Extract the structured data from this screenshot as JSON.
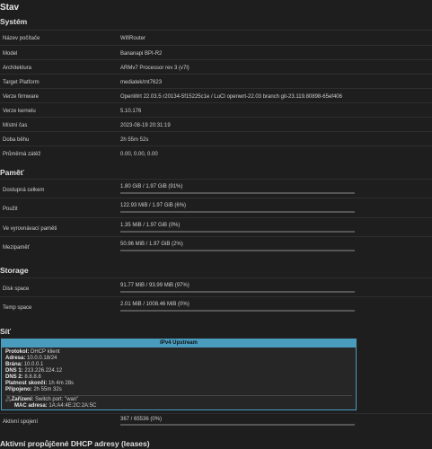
{
  "titles": {
    "main": "Stav",
    "system": "Systém",
    "memory": "Paměť",
    "storage": "Storage",
    "network": "Síť",
    "dhcp": "Aktivní propůjčené DHCP adresy (leases)"
  },
  "system": [
    {
      "label": "Název počítače",
      "value": "WifiRouter"
    },
    {
      "label": "Model",
      "value": "Bananapi BPI-R2"
    },
    {
      "label": "Architektura",
      "value": "ARMv7 Processor rev 3 (v7l)"
    },
    {
      "label": "Target Platform",
      "value": "mediatek/mt7623"
    },
    {
      "label": "Verze firmware",
      "value": "OpenWrt 22.03.5 r20134-5f15225c1e / LuCI openwrt-22.03 branch git-23.119.80898-65ef406"
    },
    {
      "label": "Verze kernelu",
      "value": "5.10.176"
    },
    {
      "label": "Místní čas",
      "value": "2023-08-19 20:31:19"
    },
    {
      "label": "Doba běhu",
      "value": "2h 55m 52s"
    },
    {
      "label": "Průměrná zátěž",
      "value": "0.00, 0.00, 0.00"
    }
  ],
  "memory": [
    {
      "label": "Dostupná celkem",
      "value": "1.80 GiB / 1.97 GiB (91%)",
      "fraction": 0.91
    },
    {
      "label": "Použit",
      "value": "122.93 MiB / 1.97 GiB (6%)",
      "fraction": 0.06
    },
    {
      "label": "Ve vyrovnávací paměti",
      "value": "1.35 MiB / 1.97 GiB (0%)",
      "fraction": 0.0
    },
    {
      "label": "Mezipaměť",
      "value": "50.96 MiB / 1.97 GiB (2%)",
      "fraction": 0.02
    }
  ],
  "storage": [
    {
      "label": "Disk space",
      "value": "91.77 MiB / 93.99 MiB (97%)",
      "fraction": 0.97
    },
    {
      "label": "Temp space",
      "value": "2.01 MiB / 1008.46 MiB (0%)",
      "fraction": 0.0
    }
  ],
  "wan": {
    "header": "IPv4 Upstream",
    "rows": [
      {
        "k": "Protokol:",
        "v": "DHCP klient"
      },
      {
        "k": "Adresa:",
        "v": "10.0.0.18/24"
      },
      {
        "k": "Brána:",
        "v": "10.0.0.1"
      },
      {
        "k": "DNS 1:",
        "v": "213.226.224.12"
      },
      {
        "k": "DNS 2:",
        "v": "8.8.8.8"
      },
      {
        "k": "Platnost skončí:",
        "v": "1h 4m 28s"
      },
      {
        "k": "Připojeno:",
        "v": "2h 55m 32s"
      }
    ],
    "device_label": "Zařízení:",
    "device_value": "Switch port: \"wan\"",
    "mac_label": "MAC adresa:",
    "mac_value": "1A:A4:4E:2C:2A:5C"
  },
  "connections": {
    "label": "Aktivní spojení",
    "value": "367 / 65536 (0%)",
    "fraction": 0.0056
  }
}
